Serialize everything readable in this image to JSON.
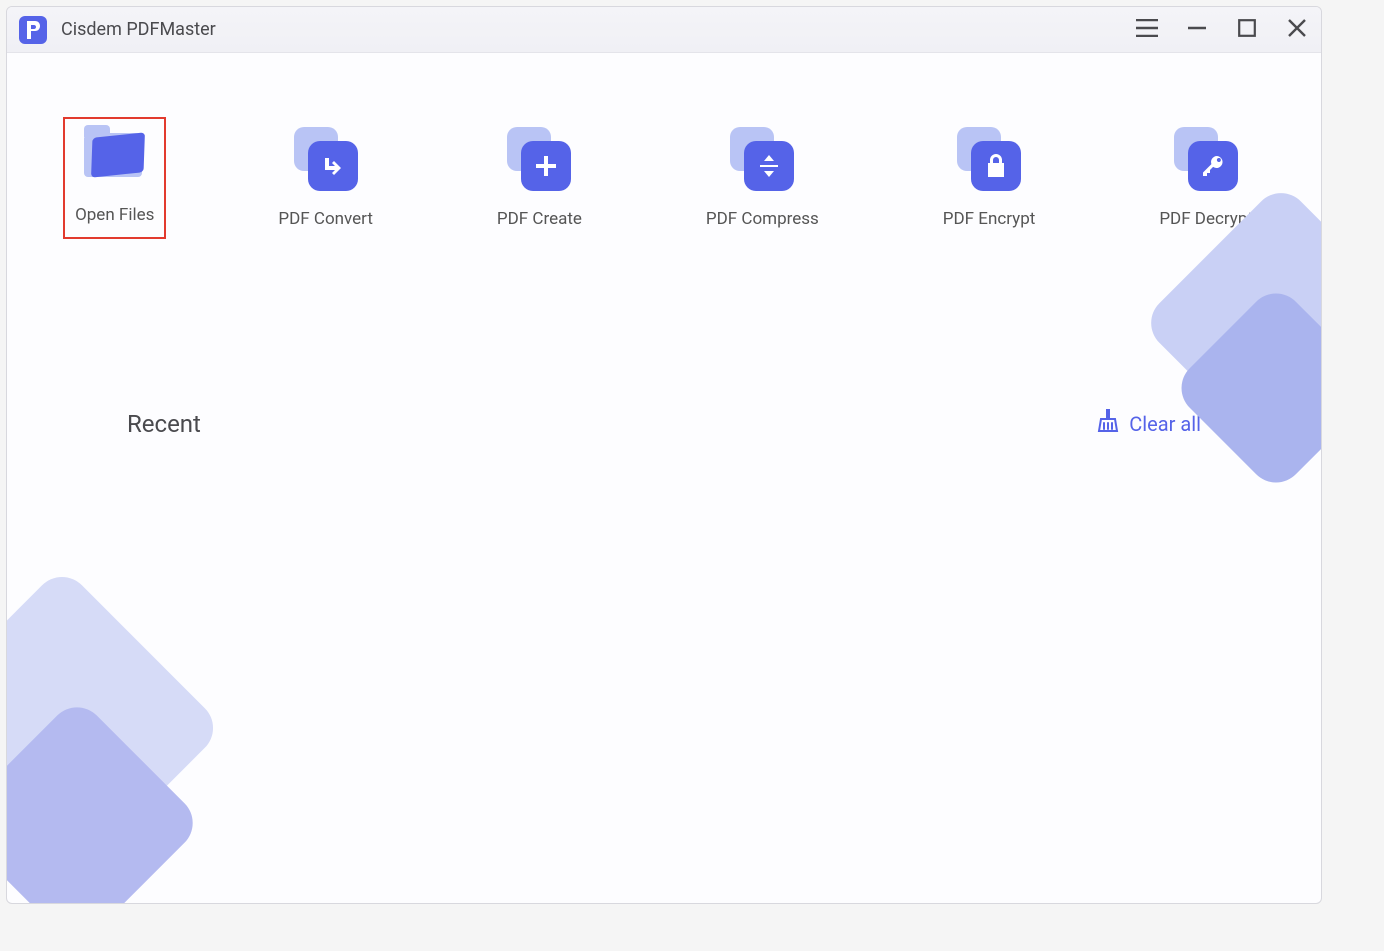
{
  "app": {
    "title": "Cisdem PDFMaster"
  },
  "actions": [
    {
      "id": "open-files",
      "label": "Open Files",
      "icon": "folder-open-icon",
      "selected": true
    },
    {
      "id": "pdf-convert",
      "label": "PDF Convert",
      "icon": "convert-icon"
    },
    {
      "id": "pdf-create",
      "label": "PDF Create",
      "icon": "plus-icon"
    },
    {
      "id": "pdf-compress",
      "label": "PDF Compress",
      "icon": "compress-icon"
    },
    {
      "id": "pdf-encrypt",
      "label": "PDF Encrypt",
      "icon": "lock-icon"
    },
    {
      "id": "pdf-decrypt",
      "label": "PDF Decrypt",
      "icon": "key-icon"
    }
  ],
  "recent": {
    "heading": "Recent",
    "clear_label": "Clear all"
  }
}
